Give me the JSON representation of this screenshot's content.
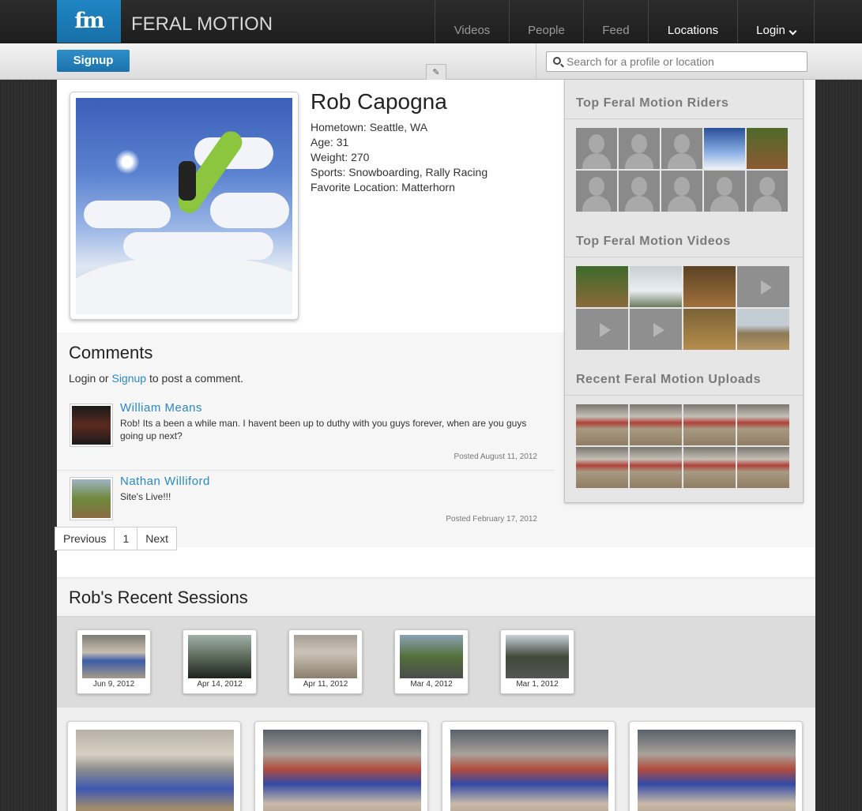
{
  "header": {
    "logo_text": "fm",
    "brand": "FERAL MOTION",
    "nav": [
      "Videos",
      "People",
      "Feed",
      "Locations",
      "Login"
    ],
    "active_nav": "Locations",
    "brand_color": "#1f86c4"
  },
  "subbar": {
    "signup_label": "Signup",
    "search_placeholder": "Search for a profile or location"
  },
  "profile": {
    "name": "Rob Capogna",
    "details": [
      "Hometown: Seattle, WA",
      "Age: 31",
      "Weight: 270",
      "Sports: Snowboarding, Rally Racing",
      "Favorite Location: Matterhorn"
    ]
  },
  "comments": {
    "title": "Comments",
    "prompt_pre": "Login or ",
    "prompt_link": "Signup",
    "prompt_post": " to post a comment.",
    "items": [
      {
        "author": "William Means",
        "text": "Rob! Its a been a while man. I havent been up to duthy with you guys forever, when are you guys going up next?",
        "date": "Posted August 11, 2012"
      },
      {
        "author": "Nathan Williford",
        "text": "Site's Live!!!",
        "date": "Posted February 17, 2012"
      }
    ],
    "pager": [
      "Previous",
      "1",
      "Next"
    ]
  },
  "sidebar": {
    "riders_title": "Top Feral Motion Riders",
    "videos_title": "Top Feral Motion Videos",
    "uploads_title": "Recent Feral Motion Uploads"
  },
  "sessions": {
    "title": "Rob's Recent Sessions",
    "dates": [
      "Jun 9, 2012",
      "Apr 14, 2012",
      "Apr 11, 2012",
      "Mar 4, 2012",
      "Mar 1, 2012"
    ]
  }
}
